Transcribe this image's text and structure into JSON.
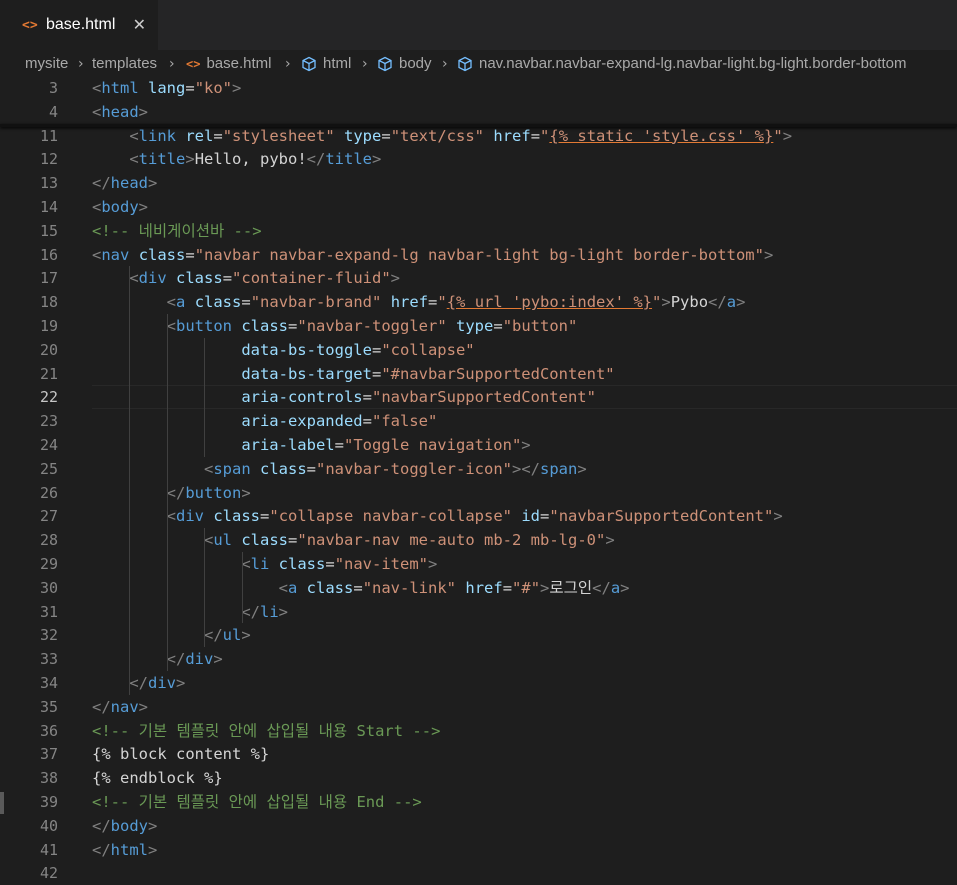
{
  "tab": {
    "icon": "<>",
    "title": "base.html",
    "close": "✕"
  },
  "breadcrumb": {
    "items": [
      {
        "label": "mysite",
        "icon": ""
      },
      {
        "label": "templates",
        "icon": ""
      },
      {
        "label": "base.html",
        "icon": "<>"
      },
      {
        "label": "html",
        "icon": "cube"
      },
      {
        "label": "body",
        "icon": "cube"
      },
      {
        "label": "nav.navbar.navbar-expand-lg.navbar-light.bg-light.border-bottom",
        "icon": "cube"
      }
    ],
    "separator": "›"
  },
  "editor": {
    "active_line": "22",
    "lines": [
      {
        "num": "3",
        "tokens": [
          [
            "b",
            "<"
          ],
          [
            "tag",
            "html"
          ],
          [
            "t",
            " "
          ],
          [
            "attr",
            "lang"
          ],
          [
            "t",
            "="
          ],
          [
            "str",
            "\"ko\""
          ],
          [
            "b",
            ">"
          ]
        ]
      },
      {
        "num": "4",
        "tokens": [
          [
            "b",
            "<"
          ],
          [
            "tag",
            "head"
          ],
          [
            "b",
            ">"
          ]
        ]
      },
      {
        "num": "11",
        "tokens": [
          [
            "t",
            "    "
          ],
          [
            "b",
            "<"
          ],
          [
            "tag",
            "link"
          ],
          [
            "t",
            " "
          ],
          [
            "attr",
            "rel"
          ],
          [
            "t",
            "="
          ],
          [
            "str",
            "\"stylesheet\""
          ],
          [
            "t",
            " "
          ],
          [
            "attr",
            "type"
          ],
          [
            "t",
            "="
          ],
          [
            "str",
            "\"text/css\""
          ],
          [
            "t",
            " "
          ],
          [
            "attr",
            "href"
          ],
          [
            "t",
            "="
          ],
          [
            "str",
            "\""
          ],
          [
            "tpl",
            "{% static 'style.css' %}"
          ],
          [
            "str",
            "\""
          ],
          [
            "b",
            ">"
          ]
        ]
      },
      {
        "num": "12",
        "tokens": [
          [
            "t",
            "    "
          ],
          [
            "b",
            "<"
          ],
          [
            "tag",
            "title"
          ],
          [
            "b",
            ">"
          ],
          [
            "t",
            "Hello, pybo!"
          ],
          [
            "b",
            "</"
          ],
          [
            "tag",
            "title"
          ],
          [
            "b",
            ">"
          ]
        ]
      },
      {
        "num": "13",
        "tokens": [
          [
            "b",
            "</"
          ],
          [
            "tag",
            "head"
          ],
          [
            "b",
            ">"
          ]
        ]
      },
      {
        "num": "14",
        "tokens": [
          [
            "b",
            "<"
          ],
          [
            "tag",
            "body"
          ],
          [
            "b",
            ">"
          ]
        ]
      },
      {
        "num": "15",
        "tokens": [
          [
            "cmt",
            "<!-- 네비게이션바 -->"
          ]
        ]
      },
      {
        "num": "16",
        "tokens": [
          [
            "b",
            "<"
          ],
          [
            "tag",
            "nav"
          ],
          [
            "t",
            " "
          ],
          [
            "attr",
            "class"
          ],
          [
            "t",
            "="
          ],
          [
            "str",
            "\"navbar navbar-expand-lg navbar-light bg-light border-bottom\""
          ],
          [
            "b",
            ">"
          ]
        ]
      },
      {
        "num": "17",
        "tokens": [
          [
            "t",
            "    "
          ],
          [
            "b",
            "<"
          ],
          [
            "tag",
            "div"
          ],
          [
            "t",
            " "
          ],
          [
            "attr",
            "class"
          ],
          [
            "t",
            "="
          ],
          [
            "str",
            "\"container-fluid\""
          ],
          [
            "b",
            ">"
          ]
        ]
      },
      {
        "num": "18",
        "tokens": [
          [
            "t",
            "        "
          ],
          [
            "b",
            "<"
          ],
          [
            "tag",
            "a"
          ],
          [
            "t",
            " "
          ],
          [
            "attr",
            "class"
          ],
          [
            "t",
            "="
          ],
          [
            "str",
            "\"navbar-brand\""
          ],
          [
            "t",
            " "
          ],
          [
            "attr",
            "href"
          ],
          [
            "t",
            "="
          ],
          [
            "str",
            "\""
          ],
          [
            "tpl",
            "{% url 'pybo:index' %}"
          ],
          [
            "str",
            "\""
          ],
          [
            "b",
            ">"
          ],
          [
            "t",
            "Pybo"
          ],
          [
            "b",
            "</"
          ],
          [
            "tag",
            "a"
          ],
          [
            "b",
            ">"
          ]
        ]
      },
      {
        "num": "19",
        "tokens": [
          [
            "t",
            "        "
          ],
          [
            "b",
            "<"
          ],
          [
            "tag",
            "button"
          ],
          [
            "t",
            " "
          ],
          [
            "attr",
            "class"
          ],
          [
            "t",
            "="
          ],
          [
            "str",
            "\"navbar-toggler\""
          ],
          [
            "t",
            " "
          ],
          [
            "attr",
            "type"
          ],
          [
            "t",
            "="
          ],
          [
            "str",
            "\"button\""
          ]
        ]
      },
      {
        "num": "20",
        "tokens": [
          [
            "t",
            "                "
          ],
          [
            "attr",
            "data-bs-toggle"
          ],
          [
            "t",
            "="
          ],
          [
            "str",
            "\"collapse\""
          ]
        ]
      },
      {
        "num": "21",
        "tokens": [
          [
            "t",
            "                "
          ],
          [
            "attr",
            "data-bs-target"
          ],
          [
            "t",
            "="
          ],
          [
            "str",
            "\"#navbarSupportedContent\""
          ]
        ]
      },
      {
        "num": "22",
        "tokens": [
          [
            "t",
            "                "
          ],
          [
            "attr",
            "aria-controls"
          ],
          [
            "t",
            "="
          ],
          [
            "str",
            "\"navbarSupportedContent\""
          ]
        ]
      },
      {
        "num": "23",
        "tokens": [
          [
            "t",
            "                "
          ],
          [
            "attr",
            "aria-expanded"
          ],
          [
            "t",
            "="
          ],
          [
            "str",
            "\"false\""
          ]
        ]
      },
      {
        "num": "24",
        "tokens": [
          [
            "t",
            "                "
          ],
          [
            "attr",
            "aria-label"
          ],
          [
            "t",
            "="
          ],
          [
            "str",
            "\"Toggle navigation\""
          ],
          [
            "b",
            ">"
          ]
        ]
      },
      {
        "num": "25",
        "tokens": [
          [
            "t",
            "            "
          ],
          [
            "b",
            "<"
          ],
          [
            "tag",
            "span"
          ],
          [
            "t",
            " "
          ],
          [
            "attr",
            "class"
          ],
          [
            "t",
            "="
          ],
          [
            "str",
            "\"navbar-toggler-icon\""
          ],
          [
            "b",
            "></"
          ],
          [
            "tag",
            "span"
          ],
          [
            "b",
            ">"
          ]
        ]
      },
      {
        "num": "26",
        "tokens": [
          [
            "t",
            "        "
          ],
          [
            "b",
            "</"
          ],
          [
            "tag",
            "button"
          ],
          [
            "b",
            ">"
          ]
        ]
      },
      {
        "num": "27",
        "tokens": [
          [
            "t",
            "        "
          ],
          [
            "b",
            "<"
          ],
          [
            "tag",
            "div"
          ],
          [
            "t",
            " "
          ],
          [
            "attr",
            "class"
          ],
          [
            "t",
            "="
          ],
          [
            "str",
            "\"collapse navbar-collapse\""
          ],
          [
            "t",
            " "
          ],
          [
            "attr",
            "id"
          ],
          [
            "t",
            "="
          ],
          [
            "str",
            "\"navbarSupportedContent\""
          ],
          [
            "b",
            ">"
          ]
        ]
      },
      {
        "num": "28",
        "tokens": [
          [
            "t",
            "            "
          ],
          [
            "b",
            "<"
          ],
          [
            "tag",
            "ul"
          ],
          [
            "t",
            " "
          ],
          [
            "attr",
            "class"
          ],
          [
            "t",
            "="
          ],
          [
            "str",
            "\"navbar-nav me-auto mb-2 mb-lg-0\""
          ],
          [
            "b",
            ">"
          ]
        ]
      },
      {
        "num": "29",
        "tokens": [
          [
            "t",
            "                "
          ],
          [
            "b",
            "<"
          ],
          [
            "tag",
            "li"
          ],
          [
            "t",
            " "
          ],
          [
            "attr",
            "class"
          ],
          [
            "t",
            "="
          ],
          [
            "str",
            "\"nav-item\""
          ],
          [
            "b",
            ">"
          ]
        ]
      },
      {
        "num": "30",
        "tokens": [
          [
            "t",
            "                    "
          ],
          [
            "b",
            "<"
          ],
          [
            "tag",
            "a"
          ],
          [
            "t",
            " "
          ],
          [
            "attr",
            "class"
          ],
          [
            "t",
            "="
          ],
          [
            "str",
            "\"nav-link\""
          ],
          [
            "t",
            " "
          ],
          [
            "attr",
            "href"
          ],
          [
            "t",
            "="
          ],
          [
            "str",
            "\"#\""
          ],
          [
            "b",
            ">"
          ],
          [
            "t",
            "로그인"
          ],
          [
            "b",
            "</"
          ],
          [
            "tag",
            "a"
          ],
          [
            "b",
            ">"
          ]
        ]
      },
      {
        "num": "31",
        "tokens": [
          [
            "t",
            "                "
          ],
          [
            "b",
            "</"
          ],
          [
            "tag",
            "li"
          ],
          [
            "b",
            ">"
          ]
        ]
      },
      {
        "num": "32",
        "tokens": [
          [
            "t",
            "            "
          ],
          [
            "b",
            "</"
          ],
          [
            "tag",
            "ul"
          ],
          [
            "b",
            ">"
          ]
        ]
      },
      {
        "num": "33",
        "tokens": [
          [
            "t",
            "        "
          ],
          [
            "b",
            "</"
          ],
          [
            "tag",
            "div"
          ],
          [
            "b",
            ">"
          ]
        ]
      },
      {
        "num": "34",
        "tokens": [
          [
            "t",
            "    "
          ],
          [
            "b",
            "</"
          ],
          [
            "tag",
            "div"
          ],
          [
            "b",
            ">"
          ]
        ]
      },
      {
        "num": "35",
        "tokens": [
          [
            "b",
            "</"
          ],
          [
            "tag",
            "nav"
          ],
          [
            "b",
            ">"
          ]
        ]
      },
      {
        "num": "36",
        "tokens": [
          [
            "cmt",
            "<!-- 기본 템플릿 안에 삽입될 내용 Start -->"
          ]
        ]
      },
      {
        "num": "37",
        "tokens": [
          [
            "t",
            "{% block content %}"
          ]
        ]
      },
      {
        "num": "38",
        "tokens": [
          [
            "t",
            "{% endblock %}"
          ]
        ]
      },
      {
        "num": "39",
        "tokens": [
          [
            "cmt",
            "<!-- 기본 템플릿 안에 삽입될 내용 End -->"
          ]
        ]
      },
      {
        "num": "40",
        "tokens": [
          [
            "b",
            "</"
          ],
          [
            "tag",
            "body"
          ],
          [
            "b",
            ">"
          ]
        ]
      },
      {
        "num": "41",
        "tokens": [
          [
            "b",
            "</"
          ],
          [
            "tag",
            "html"
          ],
          [
            "b",
            ">"
          ]
        ]
      },
      {
        "num": "42",
        "tokens": []
      }
    ]
  },
  "colors": {
    "background": "#1e1e1e",
    "tag": "#569cd6",
    "attribute": "#9cdcfe",
    "string": "#ce9178",
    "comment": "#6a9955",
    "text": "#d4d4d4",
    "bracket": "#808080"
  }
}
